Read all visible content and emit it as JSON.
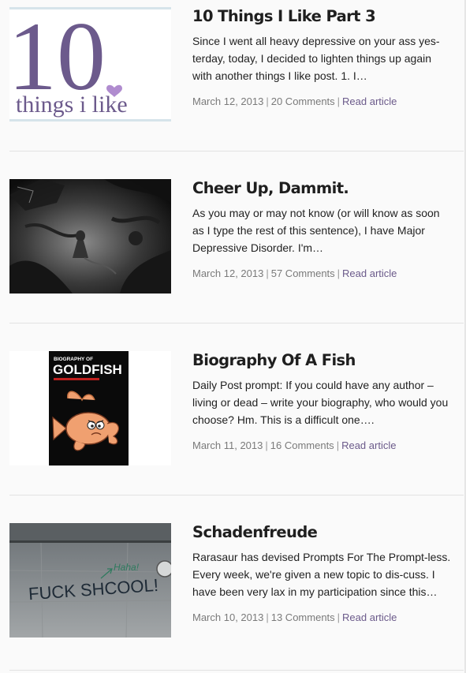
{
  "posts": [
    {
      "title": "10 Things I Like Part 3",
      "excerpt": "Since I went all heavy depressive on your ass yes-terday, today, I decided to lighten things up again with another things I like post. 1. I…",
      "date": "March 12, 2013",
      "comments": "20 Comments",
      "read_more": "Read article",
      "thumb": {
        "big": "10",
        "small": "things i like",
        "colors": {
          "ink": "#6c5a8c",
          "heart": "#b08ccf",
          "border": "#d6e4ea"
        }
      }
    },
    {
      "title": "Cheer Up, Dammit.",
      "excerpt": "As you may or may not know (or will know as soon as I type the rest of this sentence), I have Major Depressive Disorder. I'm…",
      "date": "March 12, 2013",
      "comments": "57 Comments",
      "read_more": "Read article"
    },
    {
      "title": "Biography Of A Fish",
      "excerpt": "Daily Post prompt: If you could have any author –living or dead – write your biography, who would you choose? Hm. This is a difficult one….",
      "date": "March 11, 2013",
      "comments": "16 Comments",
      "read_more": "Read article",
      "thumb": {
        "top": "BIOGRAPHY OF",
        "big": "GOLDFISH",
        "colors": {
          "bar": "#c0201e",
          "fish": "#f0a070"
        }
      }
    },
    {
      "title": "Schadenfreude",
      "excerpt": "Rarasaur has devised Prompts For The Prompt-less. Every week, we're given a new topic to dis-cuss. I have been very lax in my participation since this…",
      "date": "March 10, 2013",
      "comments": "13 Comments",
      "read_more": "Read article",
      "thumb": {
        "graffiti": "FUCK SHCOOL!",
        "note": "Haha!",
        "colors": {
          "paint": "#1e2a36",
          "note": "#2e7a5e"
        }
      }
    }
  ],
  "colors": {
    "link": "#6b5a8a",
    "meta": "#7a7a7a"
  }
}
